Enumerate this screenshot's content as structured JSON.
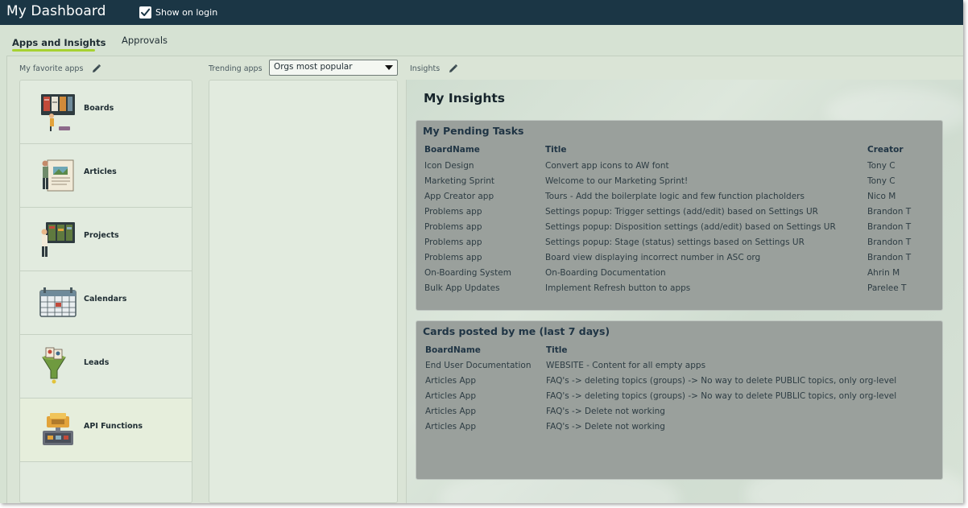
{
  "header": {
    "title": "My Dashboard",
    "show_on_login_label": "Show on login",
    "show_on_login_checked": true
  },
  "tabs": [
    {
      "label": "Apps and Insights",
      "active": true
    },
    {
      "label": "Approvals",
      "active": false
    }
  ],
  "favorites": {
    "label": "My favorite apps",
    "items": [
      {
        "label": "Boards",
        "icon": "boards-icon"
      },
      {
        "label": "Articles",
        "icon": "articles-icon"
      },
      {
        "label": "Projects",
        "icon": "projects-icon"
      },
      {
        "label": "Calendars",
        "icon": "calendars-icon"
      },
      {
        "label": "Leads",
        "icon": "leads-icon"
      },
      {
        "label": "API Functions",
        "icon": "api-functions-icon"
      }
    ]
  },
  "trending": {
    "label": "Trending apps",
    "selected_option": "Orgs most popular"
  },
  "insights": {
    "label": "Insights",
    "title": "My Insights",
    "pending_tasks": {
      "title": "My Pending Tasks",
      "headers": [
        "BoardName",
        "Title",
        "Creator"
      ],
      "rows": [
        [
          "Icon Design",
          "Convert app icons to AW font",
          "Tony C"
        ],
        [
          "Marketing Sprint",
          "Welcome to our Marketing Sprint!",
          "Tony C"
        ],
        [
          "App Creator app",
          "Tours - Add the boilerplate logic and few function placholders",
          "Nico M"
        ],
        [
          "Problems app",
          "Settings popup: Trigger settings (add/edit) based on Settings UR",
          "Brandon T"
        ],
        [
          "Problems app",
          "Settings popup: Disposition settings (add/edit) based on Settings UR",
          "Brandon T"
        ],
        [
          "Problems app",
          "Settings popup: Stage (status) settings based on Settings UR",
          "Brandon T"
        ],
        [
          "Problems app",
          "Board view displaying incorrect number in ASC org",
          "Brandon T"
        ],
        [
          "On-Boarding System",
          "On-Boarding Documentation",
          "Ahrin M"
        ],
        [
          "Bulk App Updates",
          "Implement Refresh button to apps",
          "Parelee T"
        ]
      ]
    },
    "cards_posted": {
      "title": "Cards posted by me (last 7 days)",
      "headers": [
        "BoardName",
        "Title"
      ],
      "rows": [
        [
          "End User Documentation",
          "WEBSITE - Content for all empty apps"
        ],
        [
          "Articles App",
          "FAQ's -> deleting topics (groups) -> No way to delete PUBLIC topics, only org-level"
        ],
        [
          "Articles App",
          "FAQ's -> deleting topics (groups) -> No way to delete PUBLIC topics, only org-level"
        ],
        [
          "Articles App",
          "FAQ's -> Delete not working"
        ],
        [
          "Articles App",
          "FAQ's -> Delete not working"
        ]
      ]
    }
  },
  "colors": {
    "header_bg": "#1b3645",
    "accent_underline": "#a6d131",
    "card_bg": "#9aa09c",
    "panel_bg": "#e2ebdf"
  }
}
